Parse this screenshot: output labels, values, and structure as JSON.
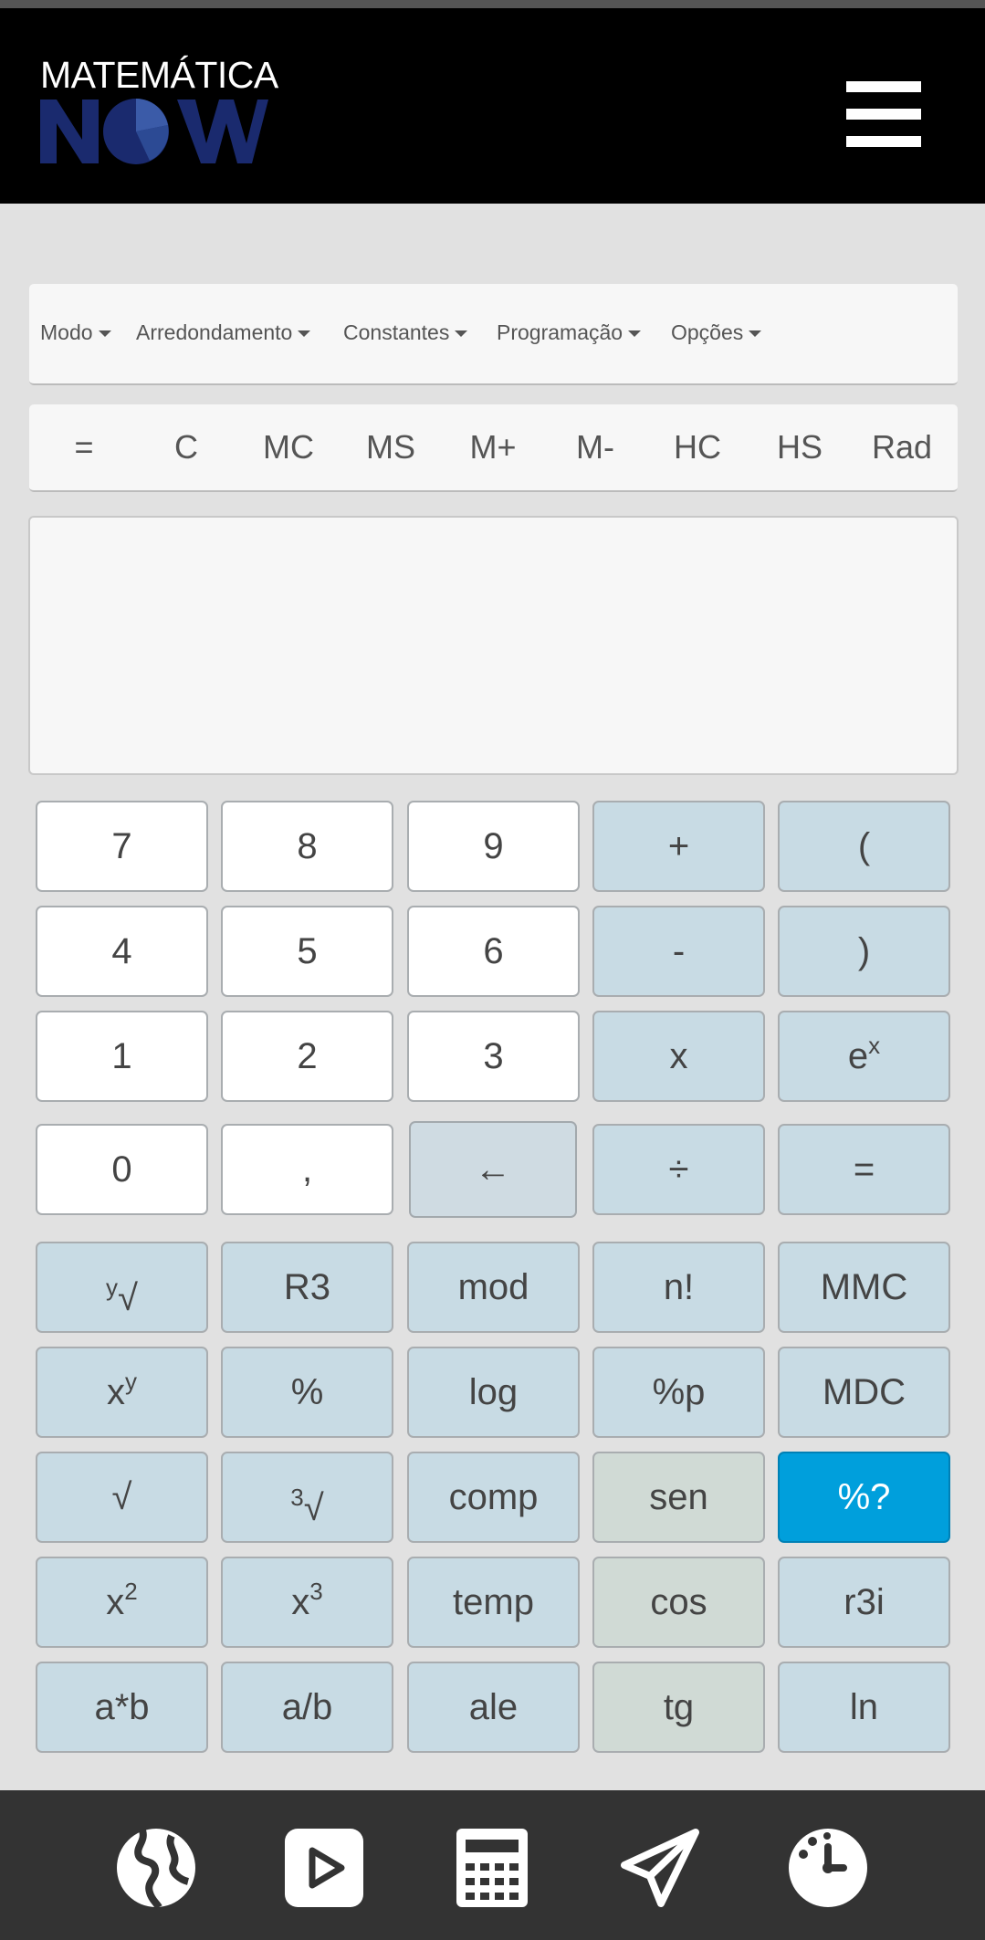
{
  "header": {
    "logo_top": "MATEMÁTICA",
    "logo_bottom": "NOW"
  },
  "menu": {
    "items": [
      "Modo",
      "Arredondamento",
      "Constantes",
      "Programação",
      "Opções"
    ]
  },
  "toolbar": {
    "buttons": [
      "=",
      "C",
      "MC",
      "MS",
      "M+",
      "M-",
      "HC",
      "HS",
      "Rad"
    ]
  },
  "display": {
    "value": ""
  },
  "keypad": {
    "row1": [
      "7",
      "8",
      "9",
      "+",
      "("
    ],
    "row2": [
      "4",
      "5",
      "6",
      "-",
      ")"
    ],
    "row3": [
      "1",
      "2",
      "3",
      "x",
      "e",
      "x"
    ],
    "row4": [
      "0",
      ",",
      "←",
      "÷",
      "="
    ],
    "row5": [
      "y",
      "√",
      "R3",
      "mod",
      "n!",
      "MMC"
    ],
    "row6": [
      "x",
      "y",
      "%",
      "log",
      "%p",
      "MDC"
    ],
    "row7": [
      "√",
      "3",
      "√",
      "comp",
      "sen",
      "%?"
    ],
    "row8": [
      "x",
      "2",
      "x",
      "3",
      "temp",
      "cos",
      "r3i"
    ],
    "row9": [
      "a*b",
      "a/b",
      "ale",
      "tg",
      "ln"
    ]
  },
  "colors": {
    "header_bg": "#000000",
    "accent_key": "#009fdc",
    "operator_key": "#c8dbe4",
    "trig_key": "#d0dad5",
    "bottom_bar": "#333333"
  },
  "bottom_nav": {
    "icons": [
      "globe-icon",
      "play-icon",
      "calculator-icon",
      "paper-plane-icon",
      "clock-icon"
    ]
  }
}
